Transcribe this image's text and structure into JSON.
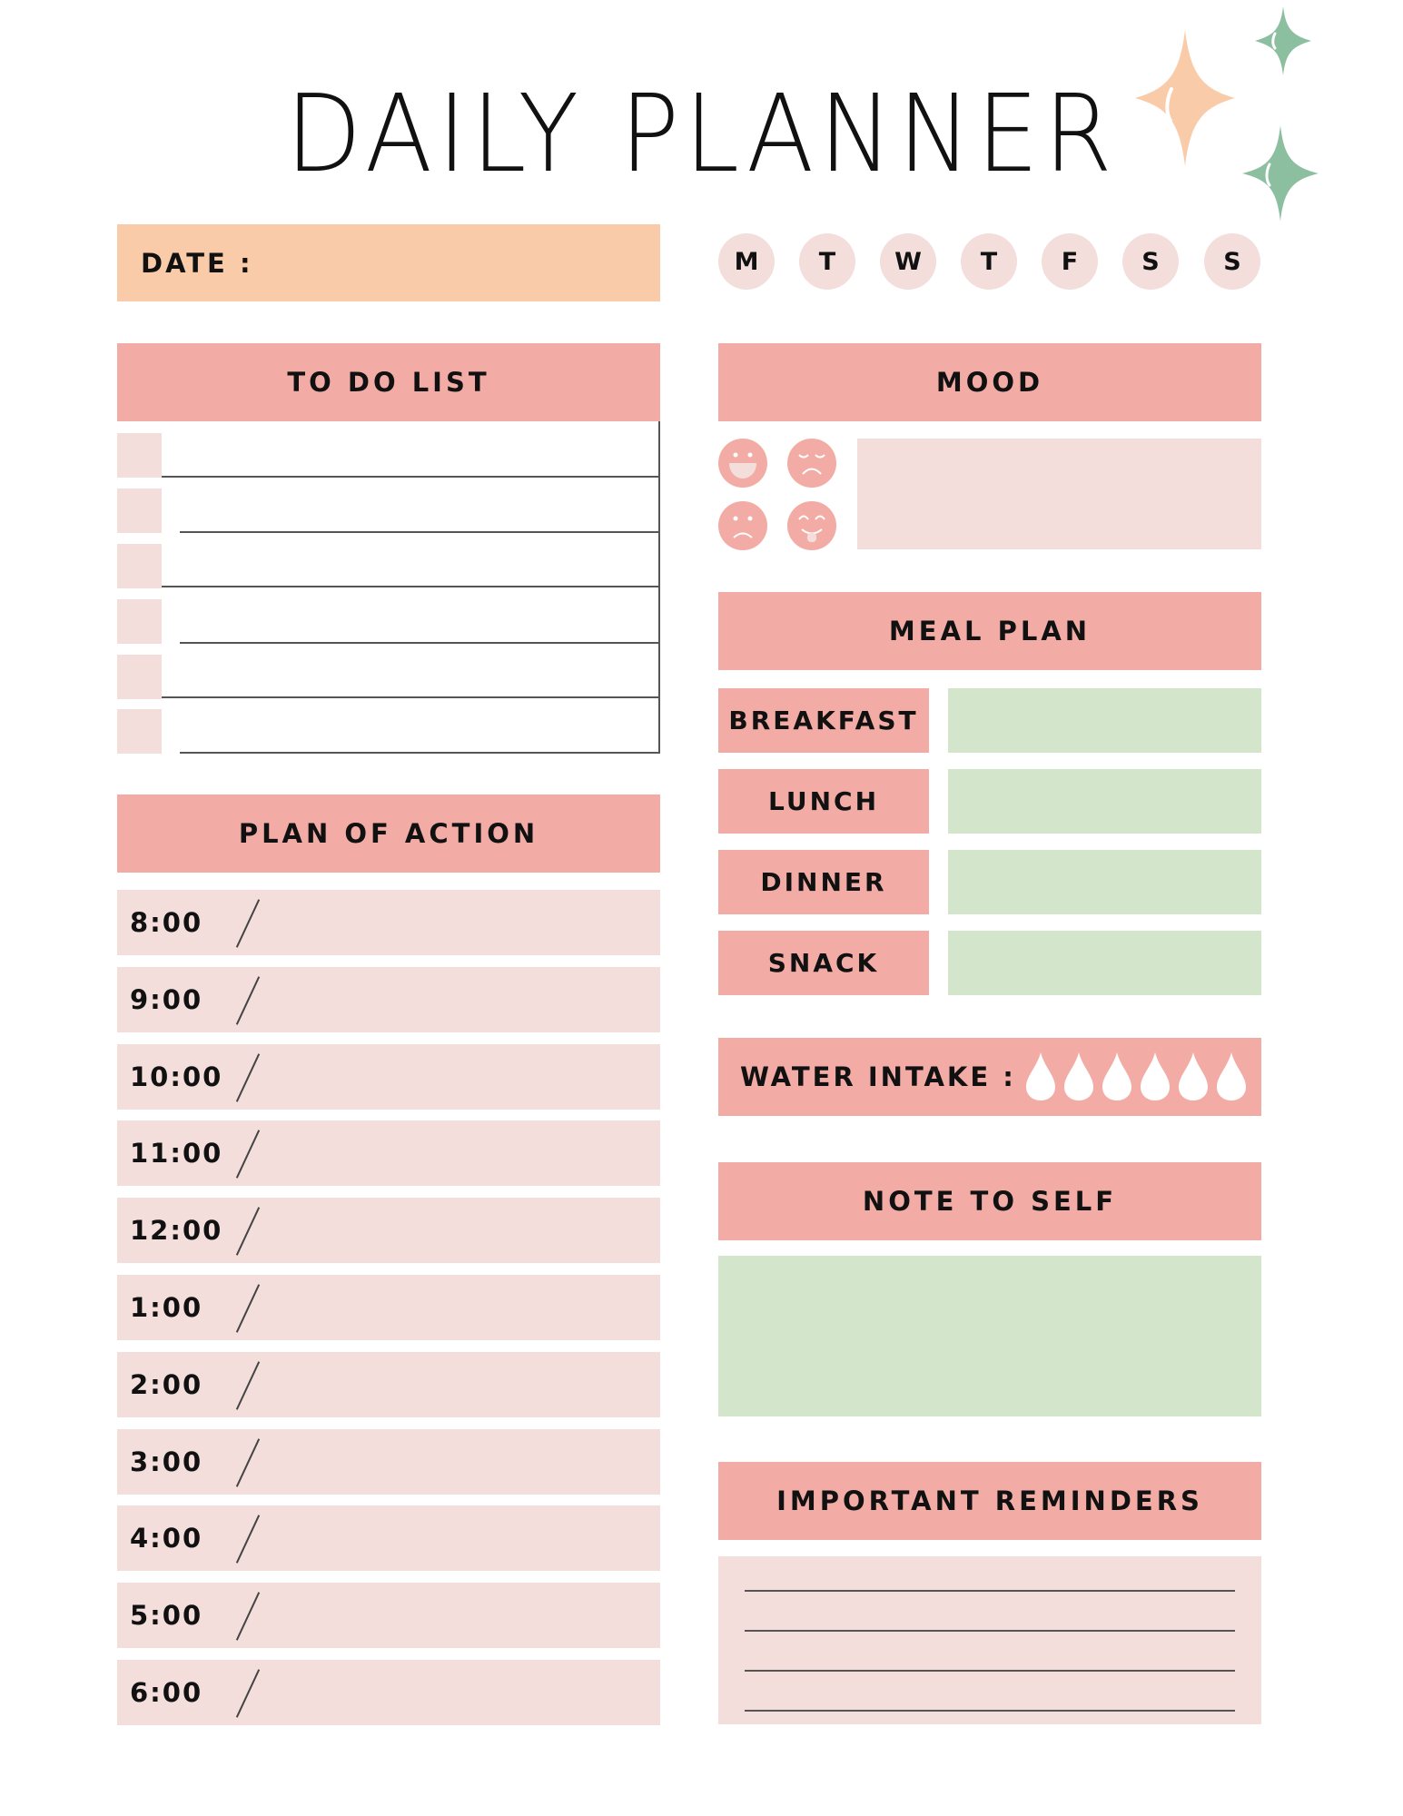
{
  "title": "DAILY PLANNER",
  "colors": {
    "header_pink": "#f2aca5",
    "light_pink": "#f3dedc",
    "peach": "#f9cba8",
    "mint": "#d3e6cb",
    "sparkle_green": "#8bbf9f",
    "sparkle_peach": "#f9cba8"
  },
  "date": {
    "label": "DATE :"
  },
  "weekdays": [
    "M",
    "T",
    "W",
    "T",
    "F",
    "S",
    "S"
  ],
  "todo": {
    "title": "TO DO LIST",
    "item_count": 6
  },
  "plan": {
    "title": "PLAN OF ACTION",
    "times": [
      "8:00",
      "9:00",
      "10:00",
      "11:00",
      "12:00",
      "1:00",
      "2:00",
      "3:00",
      "4:00",
      "5:00",
      "6:00"
    ]
  },
  "mood": {
    "title": "MOOD",
    "faces": [
      "laughing-face-icon",
      "sad-closed-eyes-face-icon",
      "frown-face-icon",
      "tongue-out-face-icon"
    ]
  },
  "meal_plan": {
    "title": "MEAL PLAN",
    "meals": [
      "BREAKFAST",
      "LUNCH",
      "DINNER",
      "SNACK"
    ]
  },
  "water": {
    "label": "WATER INTAKE :",
    "drops": 6
  },
  "note": {
    "title": "NOTE TO SELF"
  },
  "reminders": {
    "title": "IMPORTANT REMINDERS",
    "line_count": 4
  }
}
